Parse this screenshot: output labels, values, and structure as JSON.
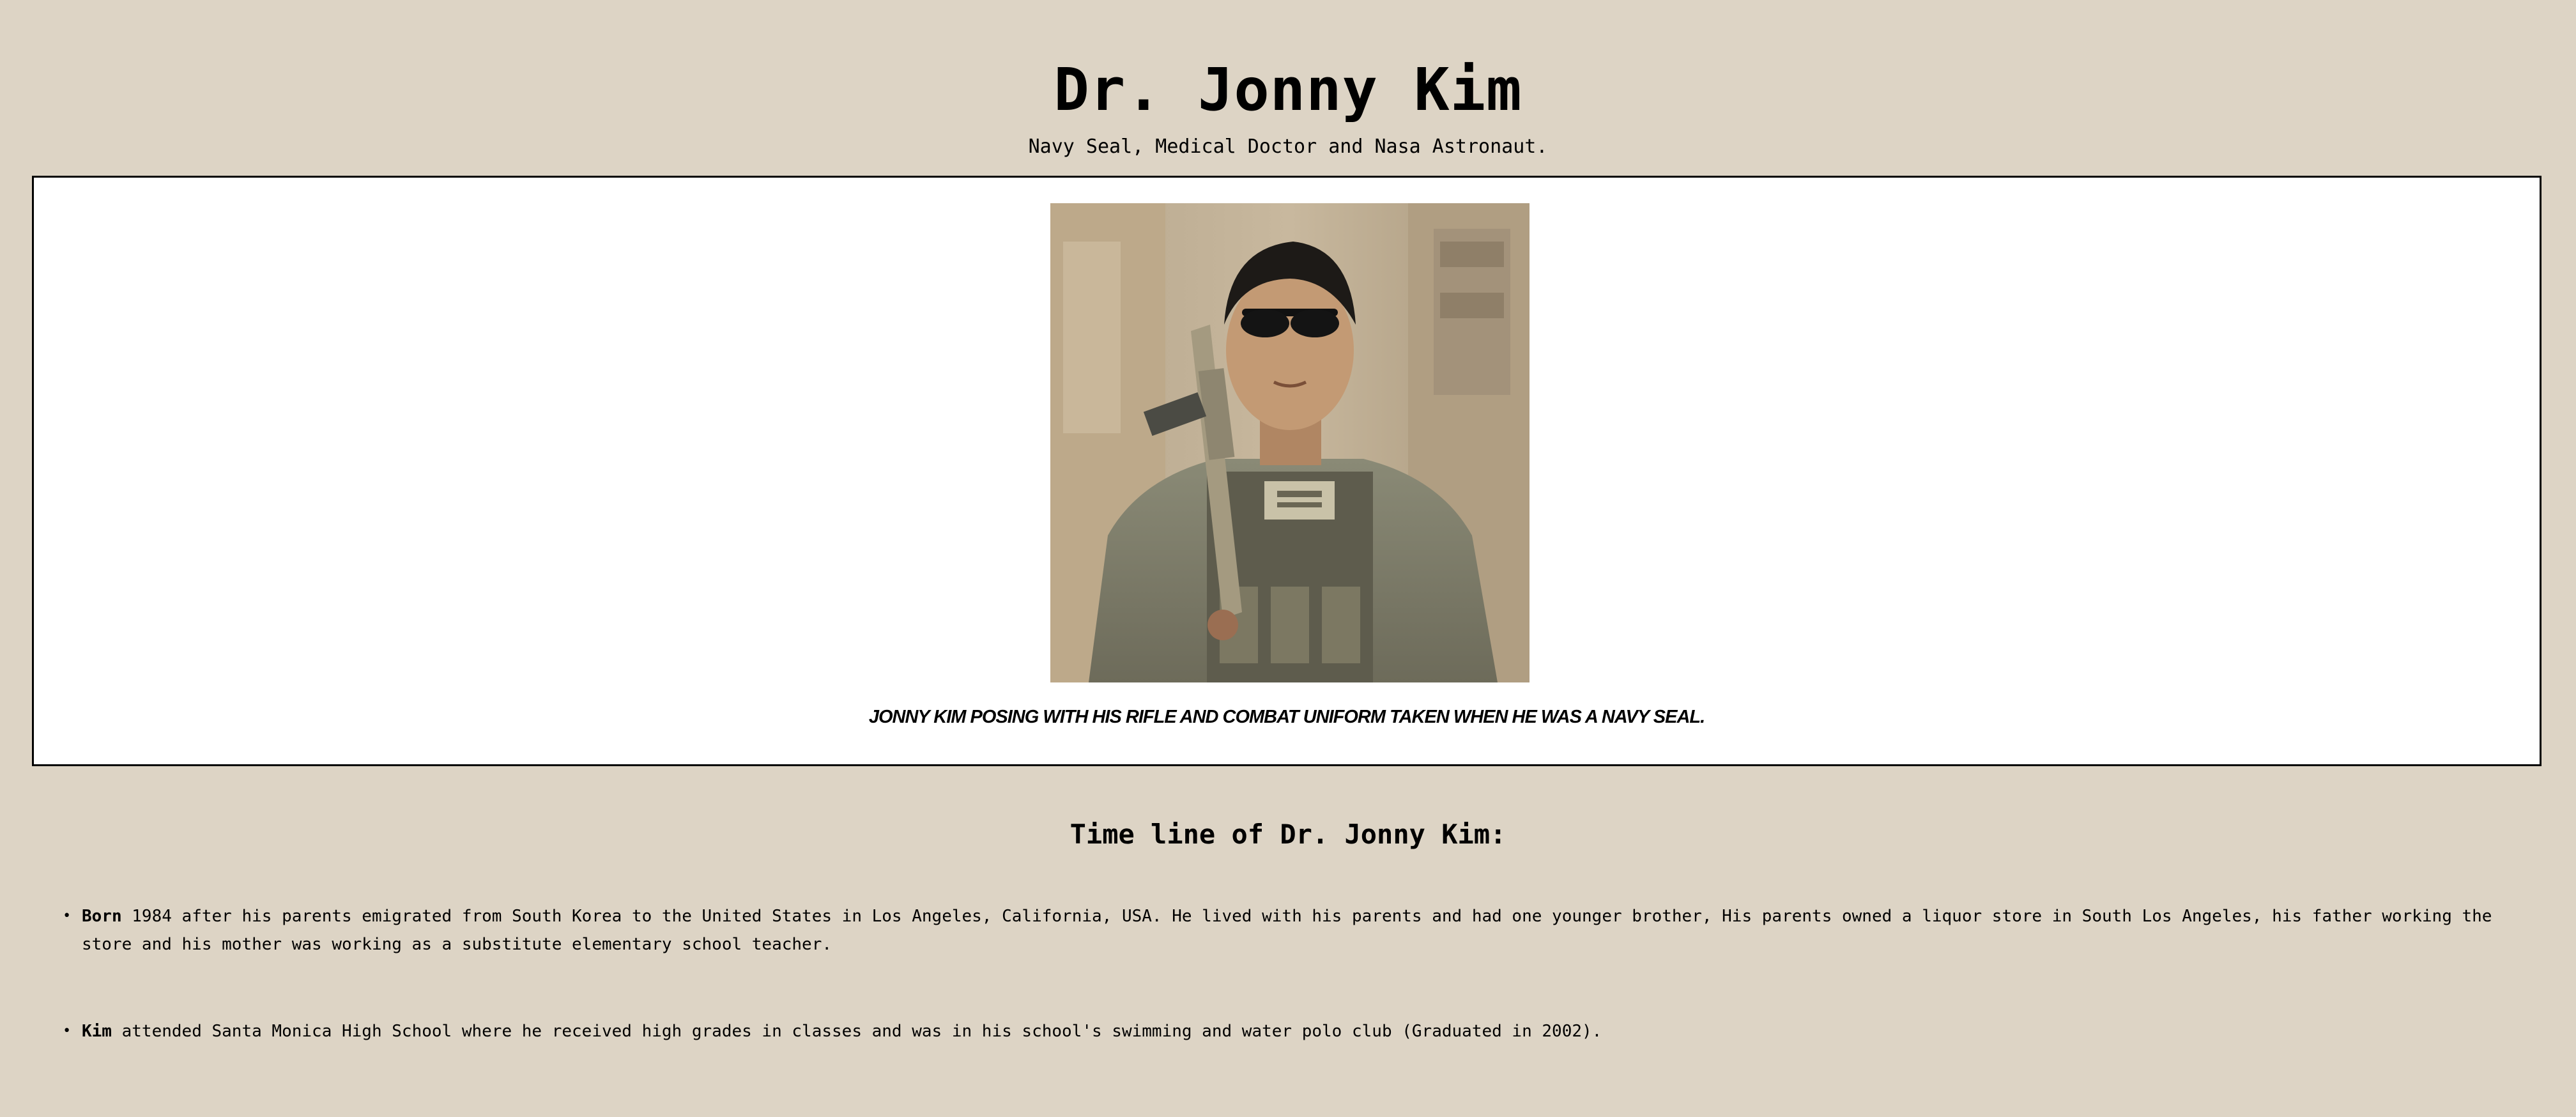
{
  "header": {
    "title": "Dr. Jonny Kim",
    "subtitle": "Navy Seal, Medical Doctor and Nasa Astronaut."
  },
  "figure": {
    "caption": "JONNY KIM POSING WITH HIS RIFLE AND COMBAT UNIFORM TAKEN WHEN HE WAS A NAVY SEAL."
  },
  "timeline": {
    "heading": "Time line of Dr. Jonny Kim:",
    "items": [
      {
        "label": "Born",
        "text": " 1984 after his parents emigrated from South Korea to the United States in Los Angeles, California, USA. He lived with his parents and had one younger brother, His parents owned a liquor store in South Los Angeles, his father working the store and his mother was working as a substitute elementary school teacher."
      },
      {
        "label": "Kim",
        "text": " attended Santa Monica High School where he received high grades in classes and was in his school's swimming and water polo club (Graduated in 2002)."
      }
    ]
  },
  "colors": {
    "background": "#ddd4c5",
    "figure_background": "#ffffff",
    "border": "#000000"
  }
}
